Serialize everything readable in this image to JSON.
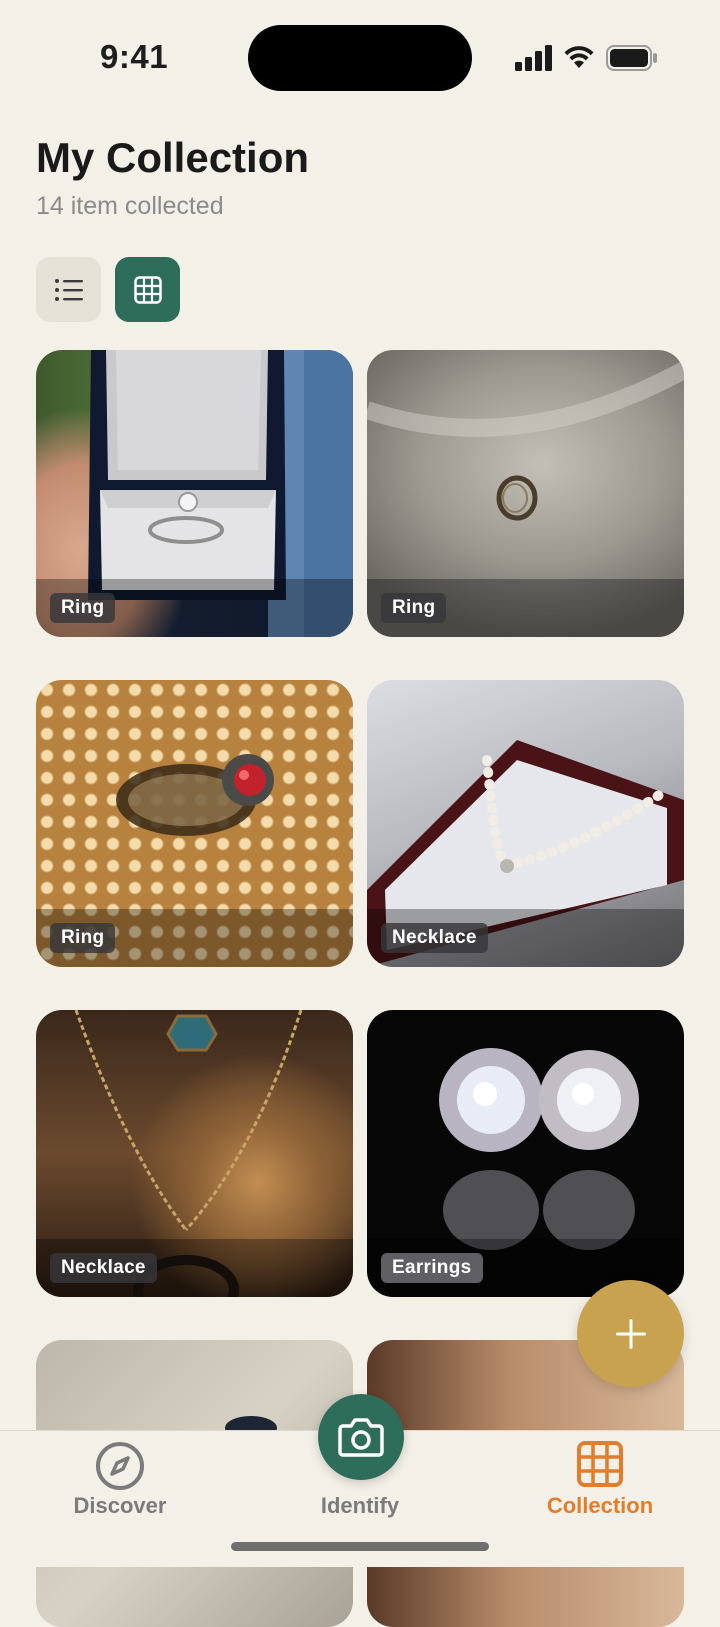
{
  "status": {
    "time": "9:41"
  },
  "header": {
    "title": "My Collection",
    "subtitle": "14 item collected"
  },
  "view_toggle": {
    "active": "grid",
    "options": [
      "list-icon",
      "grid-icon"
    ]
  },
  "items": [
    {
      "label": "Ring"
    },
    {
      "label": "Ring"
    },
    {
      "label": "Ring"
    },
    {
      "label": "Necklace"
    },
    {
      "label": "Necklace"
    },
    {
      "label": "Earrings"
    }
  ],
  "fab": {
    "icon": "plus-icon"
  },
  "tabbar": {
    "discover": "Discover",
    "identify": "Identify",
    "collection": "Collection"
  },
  "colors": {
    "background": "#f3f0e8",
    "primary": "#2f6d5b",
    "accent": "#e27d2b",
    "fab": "#c9a24f"
  }
}
